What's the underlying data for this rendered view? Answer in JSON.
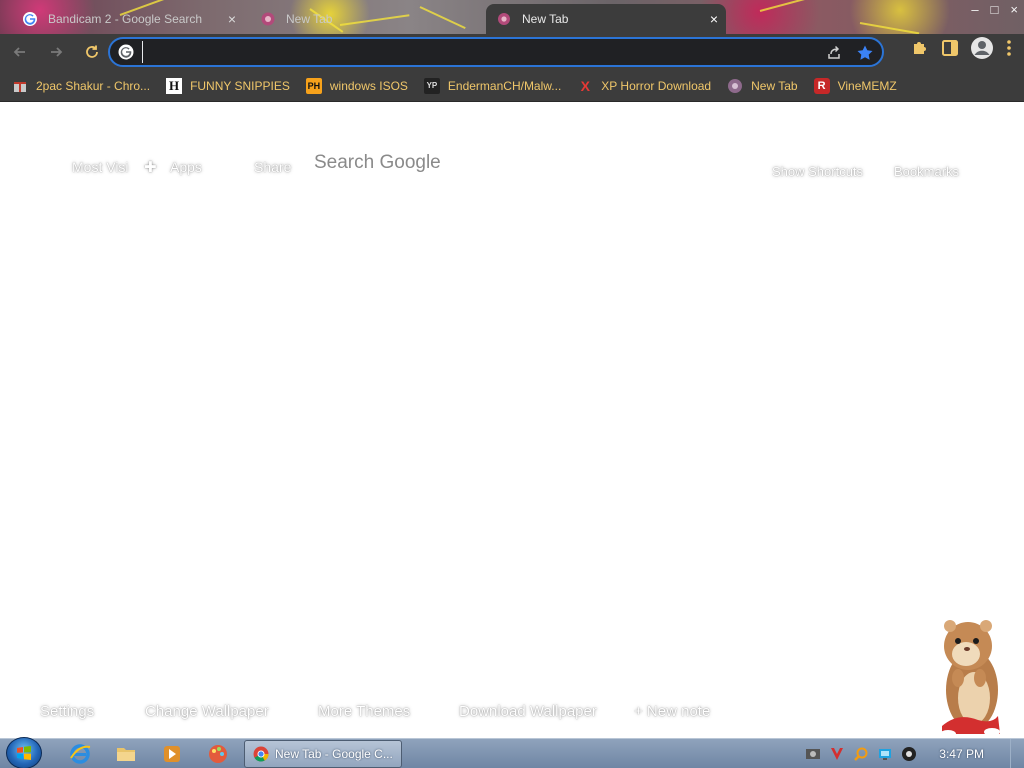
{
  "browser": {
    "tabs": [
      {
        "title": "Bandicam 2 - Google Search",
        "active": false
      },
      {
        "title": "New Tab",
        "active": false
      },
      {
        "title": "New Tab",
        "active": true
      }
    ],
    "close_glyph": "×",
    "window_controls": {
      "minimize": "–",
      "maximize": "□",
      "close": "×"
    },
    "omnibox": {
      "value": "",
      "placeholder": ""
    },
    "bookmarks": [
      {
        "label": "2pac Shakur - Chro...",
        "icon": "gift-icon",
        "icon_text": ""
      },
      {
        "label": "FUNNY SNIPPIES",
        "icon": "h-logo-icon",
        "icon_text": "H"
      },
      {
        "label": "windows ISOS",
        "icon": "ph-logo-icon",
        "icon_text": "PH"
      },
      {
        "label": "EndermanCH/Malw...",
        "icon": "yp-logo-icon",
        "icon_text": "YP"
      },
      {
        "label": "XP Horror Download",
        "icon": "x-logo-icon",
        "icon_text": "X"
      },
      {
        "label": "New Tab",
        "icon": "globe-icon",
        "icon_text": ""
      },
      {
        "label": "VineMEMZ",
        "icon": "r-logo-icon",
        "icon_text": "R"
      }
    ]
  },
  "ntp": {
    "top_links": {
      "most_visited": "Most Visi",
      "apps": "Apps",
      "share": "Share",
      "search": "Search Google",
      "show_shortcuts": "Show Shortcuts",
      "bookmarks": "Bookmarks"
    },
    "bottom_links": {
      "settings": "Settings",
      "change_wallpaper": "Change Wallpaper",
      "more_themes": "More Themes",
      "download_wallpaper": "Download Wallpaper",
      "new_note": "+ New note"
    }
  },
  "taskbar": {
    "task_label": "New Tab - Google C...",
    "clock": "3:47 PM"
  },
  "colors": {
    "accent": "#2b74d6",
    "bookmark_text": "#f0c76a",
    "chrome_dark": "#3c3c3c"
  }
}
